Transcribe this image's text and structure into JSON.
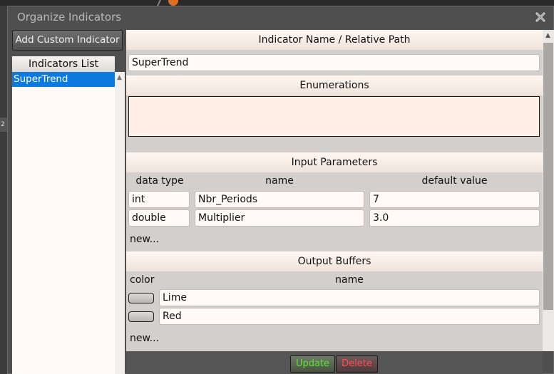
{
  "background": {
    "left_tab_label": "2"
  },
  "dialog": {
    "title": "Organize Indicators",
    "close_icon": "close-icon"
  },
  "sidebar": {
    "add_button_label": "Add Custom Indicator",
    "list_header": "Indicators List",
    "items": [
      {
        "label": "SuperTrend",
        "selected": true
      }
    ]
  },
  "indicator": {
    "name_header": "Indicator Name / Relative Path",
    "name_value": "SuperTrend",
    "enumerations_header": "Enumerations",
    "enumerations_value": ""
  },
  "input_parameters": {
    "header": "Input Parameters",
    "columns": {
      "data_type": "data type",
      "name": "name",
      "default_value": "default value"
    },
    "rows": [
      {
        "data_type": "int",
        "name": "Nbr_Periods",
        "default_value": "7"
      },
      {
        "data_type": "double",
        "name": "Multiplier",
        "default_value": "3.0"
      }
    ],
    "new_label": "new..."
  },
  "output_buffers": {
    "header": "Output Buffers",
    "columns": {
      "color": "color",
      "name": "name"
    },
    "rows": [
      {
        "name": "Lime"
      },
      {
        "name": "Red"
      }
    ],
    "new_label": "new..."
  },
  "footer": {
    "update_label": "Update",
    "delete_label": "Delete"
  },
  "colors": {
    "selection": "#0d7adf",
    "update_text": "#5de235",
    "delete_text": "#ff4d55",
    "enum_background": "#ffeee6"
  }
}
